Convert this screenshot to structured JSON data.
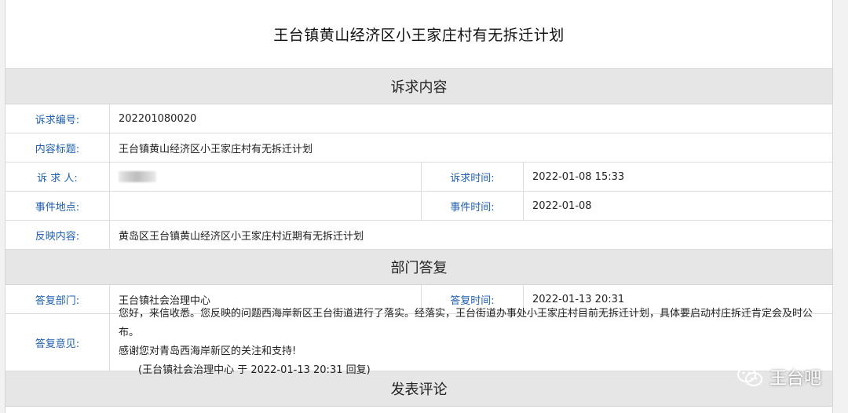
{
  "title": "王台镇黄山经济区小王家庄村有无拆迁计划",
  "sections": {
    "complaint": "诉求内容",
    "reply": "部门答复",
    "comment": "发表评论"
  },
  "complaint": {
    "number_label": "诉求编号:",
    "number": "202201080020",
    "subject_label": "内容标题:",
    "subject": "王台镇黄山经济区小王家庄村有无拆迁计划",
    "person_label": "诉 求 人:",
    "time_label": "诉求时间:",
    "time": "2022-01-08 15:33",
    "place_label": "事件地点:",
    "place": "",
    "event_time_label": "事件时间:",
    "event_time": "2022-01-08",
    "content_label": "反映内容:",
    "content": "黄岛区王台镇黄山经济区小王家庄村近期有无拆迁计划"
  },
  "reply": {
    "dept_label": "答复部门:",
    "dept": "王台镇社会治理中心",
    "time_label": "答复时间:",
    "time": "2022-01-13 20:31",
    "opinion_label": "答复意见:",
    "line1": "您好，来信收悉。您反映的问题西海岸新区王台街道进行了落实。经落实，王台街道办事处小王家庄村目前无拆迁计划，具体要启动村庄拆迁肯定会及时公布。",
    "line2": "感谢您对青岛西海岸新区的关注和支持!",
    "signature": "(王台镇社会治理中心 于 2022-01-13 20:31 回复)"
  },
  "watermark": {
    "text": "王台吧",
    "icon": "wechat-icon"
  }
}
